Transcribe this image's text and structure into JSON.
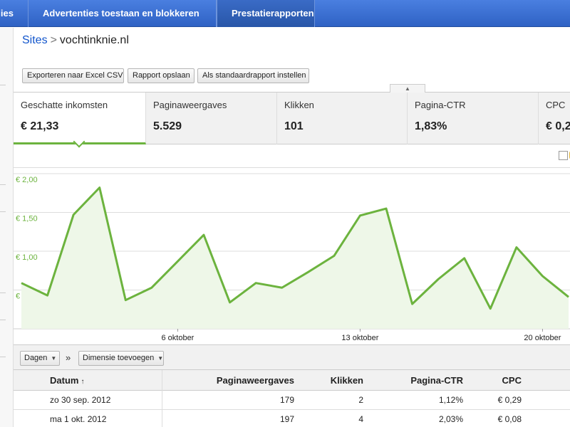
{
  "nav": {
    "tabs": [
      {
        "label": "ies"
      },
      {
        "label": "Advertenties toestaan en blokkeren"
      },
      {
        "label": "Prestatierapporten"
      }
    ]
  },
  "breadcrumb": {
    "link": "Sites",
    "separator": ">",
    "current": "vochtinknie.nl"
  },
  "toolbar": {
    "export_label": "Exporteren naar Excel CSV",
    "save_label": "Rapport opslaan",
    "default_label": "Als standaardrapport instellen"
  },
  "scorecards": [
    {
      "name": "Geschatte inkomsten",
      "value": "€ 21,33"
    },
    {
      "name": "Paginaweergaves",
      "value": "5.529"
    },
    {
      "name": "Klikken",
      "value": "101"
    },
    {
      "name": "Pagina-CTR",
      "value": "1,83%"
    },
    {
      "name": "CPC",
      "value": "€ 0,2"
    }
  ],
  "colors": {
    "accent": "#6cb33e",
    "nav": "#3b6fd0",
    "link": "#1155cc"
  },
  "chart_data": {
    "type": "area",
    "x": [
      "30 sep",
      "1 okt",
      "2 okt",
      "3 okt",
      "4 okt",
      "5 okt",
      "6 okt",
      "7 okt",
      "8 okt",
      "9 okt",
      "10 okt",
      "11 okt",
      "12 okt",
      "13 okt",
      "14 okt",
      "15 okt",
      "16 okt",
      "17 okt",
      "18 okt",
      "19 okt",
      "20 okt",
      "21 okt"
    ],
    "values": [
      0.59,
      0.43,
      1.47,
      1.82,
      0.37,
      0.53,
      0.87,
      1.21,
      0.34,
      0.59,
      0.53,
      0.73,
      0.94,
      1.46,
      1.55,
      0.32,
      0.64,
      0.91,
      0.26,
      1.05,
      0.68,
      0.41
    ],
    "yticks": [
      "€ 2,00",
      "€ 1,50",
      "€ 1,00",
      "€ 0,50"
    ],
    "ytick_values": [
      2.0,
      1.5,
      1.0,
      0.5
    ],
    "xticks": [
      {
        "label": "6 oktober",
        "index": 6
      },
      {
        "label": "13 oktober",
        "index": 13
      },
      {
        "label": "20 oktober",
        "index": 20
      }
    ],
    "ylim": [
      0,
      2.0
    ],
    "grid": true,
    "color": "#6cb33e"
  },
  "controls": {
    "period_label": "Dagen",
    "chevron": "»",
    "dimension_label": "Dimensie toevoegen"
  },
  "table": {
    "headers": [
      "Datum",
      "Paginaweergaves",
      "Klikken",
      "Pagina-CTR",
      "CPC"
    ],
    "sort_indicator": "↑",
    "rows": [
      [
        "zo 30 sep. 2012",
        "179",
        "2",
        "1,12%",
        "€ 0,29"
      ],
      [
        "ma 1 okt. 2012",
        "197",
        "4",
        "2,03%",
        "€ 0,08"
      ]
    ]
  }
}
